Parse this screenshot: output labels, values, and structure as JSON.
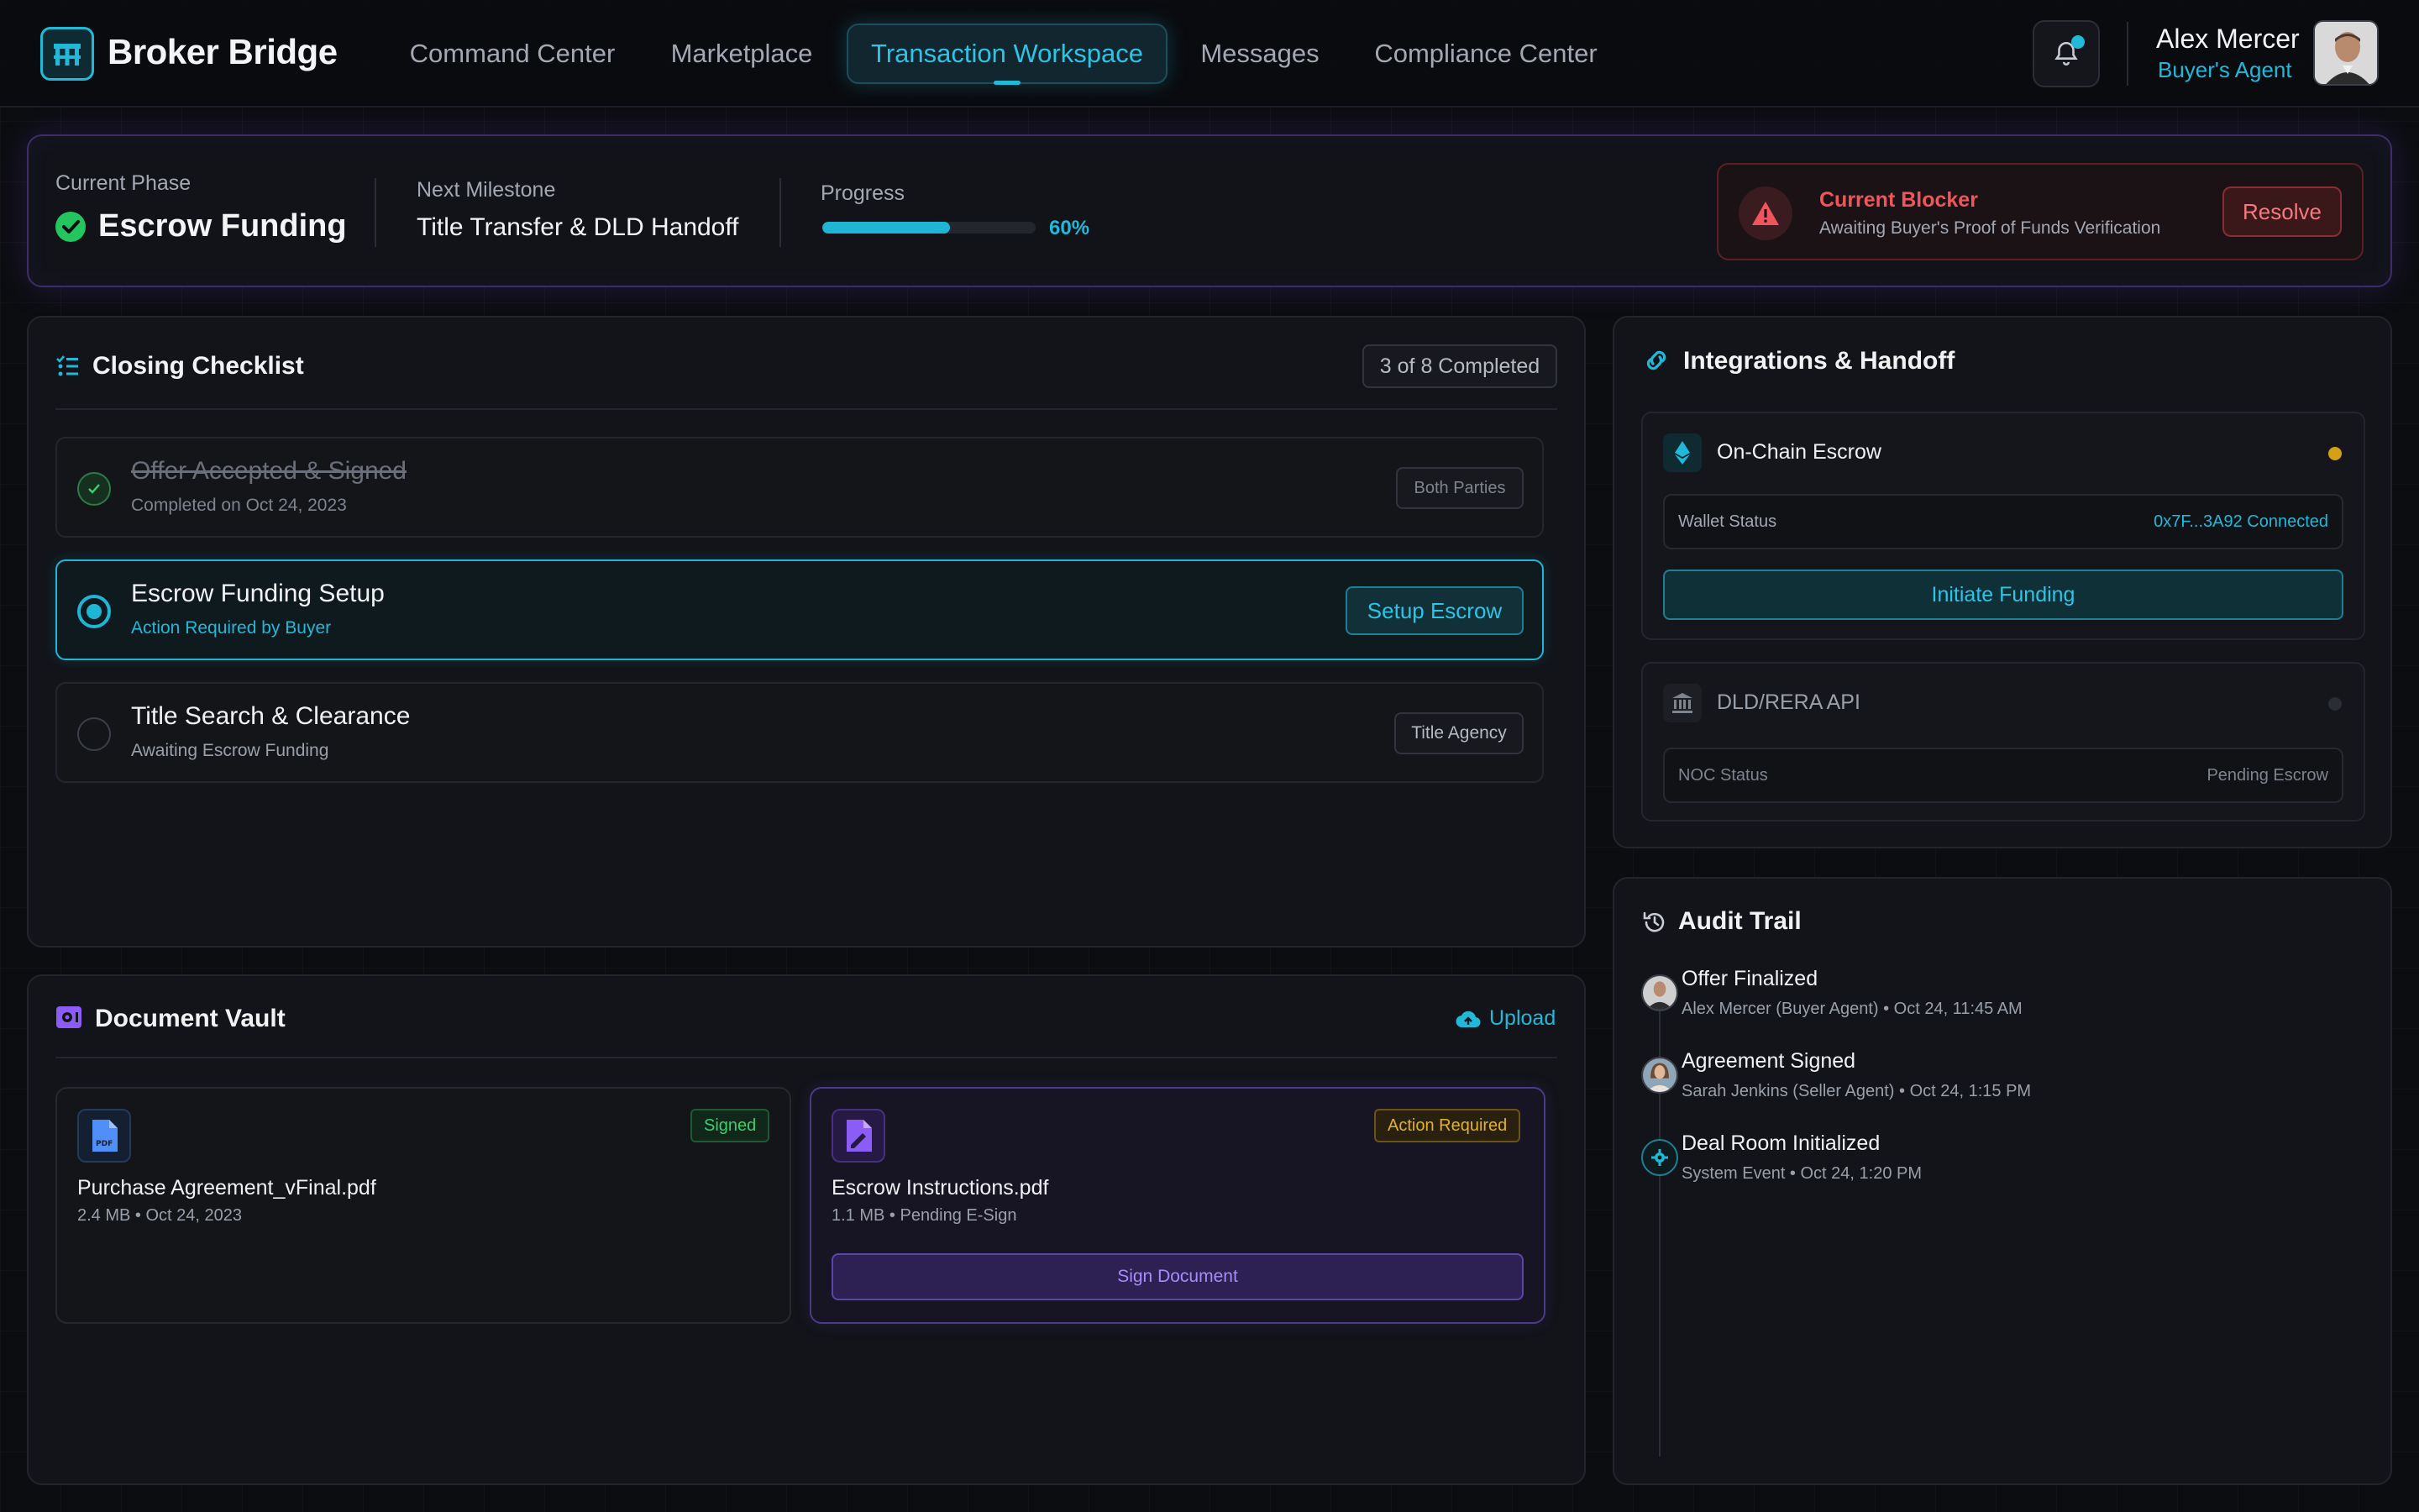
{
  "app": {
    "name": "Broker Bridge"
  },
  "nav": {
    "items": [
      "Command Center",
      "Marketplace",
      "Transaction Workspace",
      "Messages",
      "Compliance Center"
    ],
    "active": "Transaction Workspace"
  },
  "user": {
    "name": "Alex Mercer",
    "role": "Buyer's Agent"
  },
  "phase": {
    "current_label": "Current Phase",
    "current_value": "Escrow Funding",
    "milestone_label": "Next Milestone",
    "milestone_value": "Title Transfer & DLD Handoff",
    "progress_label": "Progress",
    "progress_text": "60%",
    "progress_value": 0.6
  },
  "blocker": {
    "title": "Current Blocker",
    "desc": "Awaiting Buyer's Proof of Funds Verification",
    "action": "Resolve"
  },
  "checklist": {
    "title": "Closing Checklist",
    "count": "3 of 8 Completed",
    "items": [
      {
        "title": "Offer Accepted & Signed",
        "sub": "Completed on Oct 24, 2023",
        "tag": "Both Parties",
        "state": "done"
      },
      {
        "title": "Escrow Funding Setup",
        "sub": "Action Required by Buyer",
        "tag": "Setup Escrow",
        "state": "active"
      },
      {
        "title": "Title Search & Clearance",
        "sub": "Awaiting Escrow Funding",
        "tag": "Title Agency",
        "state": "pending"
      }
    ]
  },
  "vault": {
    "title": "Document Vault",
    "upload": "Upload",
    "docs": [
      {
        "name": "Purchase Agreement_vFinal.pdf",
        "meta": "2.4 MB • Oct 24, 2023",
        "badge": "Signed"
      },
      {
        "name": "Escrow Instructions.pdf",
        "meta": "1.1 MB • Pending E-Sign",
        "badge": "Action Required",
        "action": "Sign Document"
      }
    ]
  },
  "integrations": {
    "title": "Integrations & Handoff",
    "escrow": {
      "title": "On-Chain Escrow",
      "field_label": "Wallet Status",
      "field_value": "0x7F...3A92 Connected",
      "action": "Initiate Funding"
    },
    "dld": {
      "title": "DLD/RERA API",
      "field_label": "NOC Status",
      "field_value": "Pending Escrow"
    }
  },
  "audit": {
    "title": "Audit Trail",
    "events": [
      {
        "title": "Offer Finalized",
        "meta": "Alex Mercer (Buyer Agent) • Oct 24, 11:45 AM"
      },
      {
        "title": "Agreement Signed",
        "meta": "Sarah Jenkins (Seller Agent) • Oct 24, 1:15 PM"
      },
      {
        "title": "Deal Room Initialized",
        "meta": "System Event • Oct 24, 1:20 PM"
      }
    ]
  },
  "colors": {
    "accent": "#22b8d8",
    "purple": "#8b5cf6",
    "danger": "#ef4444",
    "success": "#22c55e",
    "warning": "#d4a017"
  }
}
